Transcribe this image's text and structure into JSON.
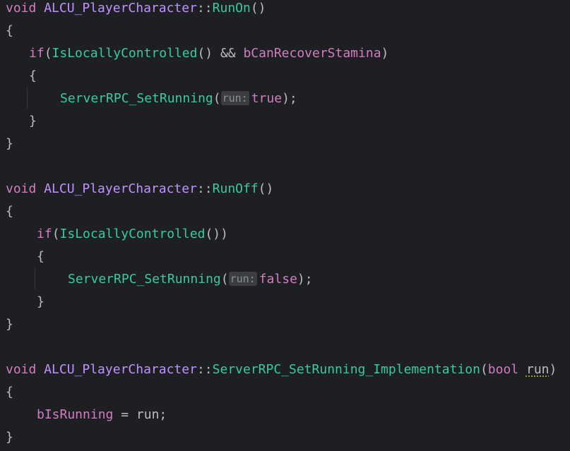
{
  "colors": {
    "background": "#1e1f22",
    "keyword": "#d37cc1",
    "type": "#c191ff",
    "function": "#39cc9b",
    "member": "#d37cc1",
    "plain": "#bdbdbd",
    "hint_bg": "#3b3d41",
    "hint_text": "#8a8d93",
    "warning_underline": "#a7a734"
  },
  "code": {
    "l1": {
      "kw": "void",
      "type": "ALCU_PlayerCharacter",
      "scope": "::",
      "fn": "RunOn",
      "rest": "()"
    },
    "l2": {
      "text": "{"
    },
    "l3": {
      "kw": "if",
      "paren": "(",
      "call": "IsLocallyControlled",
      "mid": "() && ",
      "member": "bCanRecoverStamina",
      "end": ")"
    },
    "l4": {
      "text": "{"
    },
    "l5": {
      "fn": "ServerRPC_SetRunning",
      "open": "(",
      "hint": "run:",
      "val": "true",
      "end": ");"
    },
    "l6": {
      "text": "}"
    },
    "l7": {
      "text": "}"
    },
    "l8": {
      "kw": "void",
      "type": "ALCU_PlayerCharacter",
      "scope": "::",
      "fn": "RunOff",
      "rest": "()"
    },
    "l9": {
      "text": "{"
    },
    "l10": {
      "kw": "if",
      "paren": "(",
      "call": "IsLocallyControlled",
      "end": "())"
    },
    "l11": {
      "text": "{"
    },
    "l12": {
      "fn": "ServerRPC_SetRunning",
      "open": "(",
      "hint": "run:",
      "val": "false",
      "end": ");"
    },
    "l13": {
      "text": "}"
    },
    "l14": {
      "text": "}"
    },
    "l15": {
      "kw": "void",
      "type": "ALCU_PlayerCharacter",
      "scope": "::",
      "fn": "ServerRPC_SetRunning_Implementation",
      "open": "(",
      "ptype": "bool",
      "pname": "run",
      "end": ")"
    },
    "l16": {
      "text": "{"
    },
    "l17": {
      "member": "bIsRunning",
      "mid": " = ",
      "var": "run",
      "end": ";"
    },
    "l18": {
      "text": "}"
    }
  }
}
